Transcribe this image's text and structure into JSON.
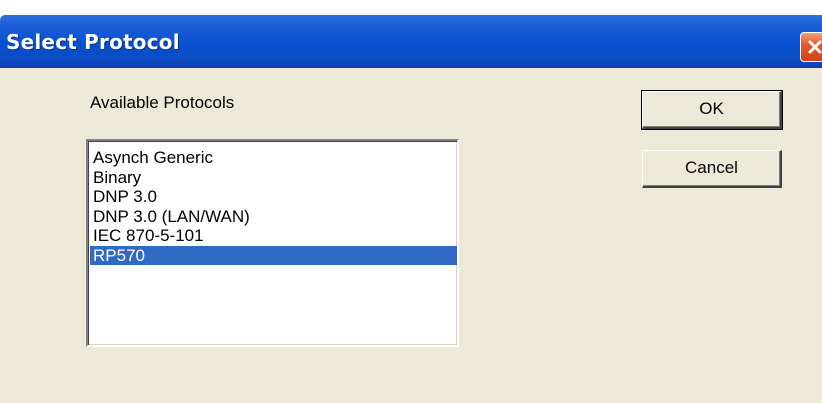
{
  "window": {
    "title": "Select Protocol"
  },
  "dialog": {
    "list_label": "Available Protocols",
    "protocols": [
      "Asynch Generic",
      "Binary",
      "DNP 3.0",
      "DNP 3.0 (LAN/WAN)",
      "IEC 870-5-101",
      "RP570"
    ],
    "selected_protocol": "RP570",
    "ok_label": "OK",
    "cancel_label": "Cancel"
  },
  "icons": {
    "close": "close-icon"
  },
  "colors": {
    "titlebar": "#0a4fd0",
    "selection": "#316ac5",
    "client_background": "#ece9d8",
    "close_button": "#e45b2d"
  }
}
